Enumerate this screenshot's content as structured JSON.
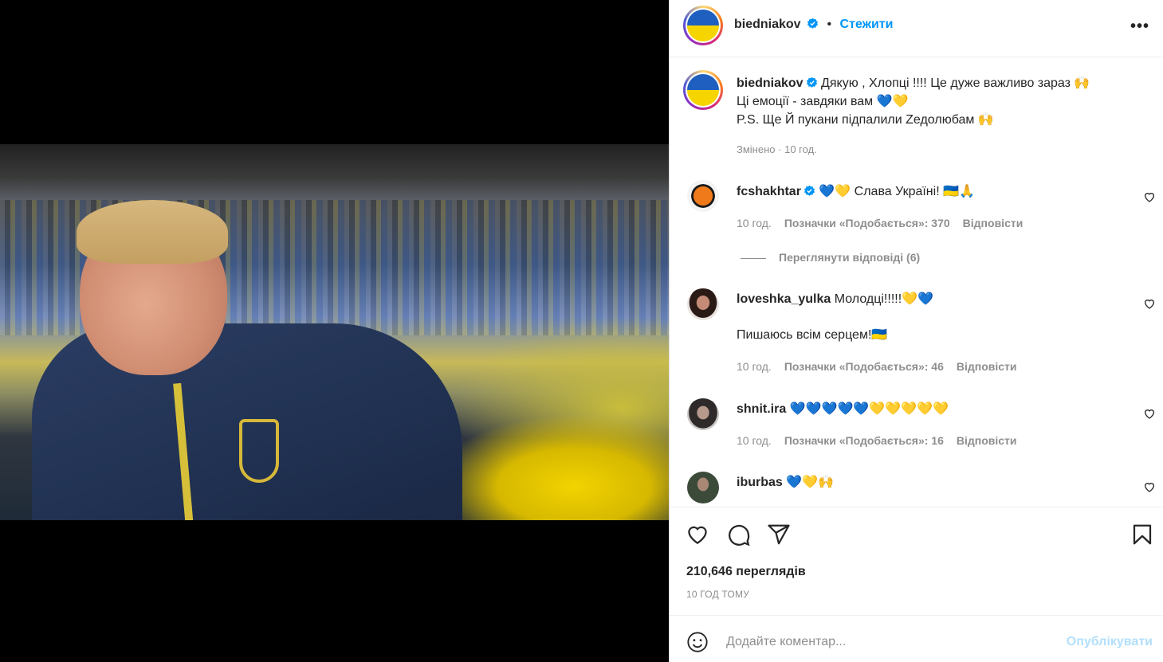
{
  "header": {
    "username": "biedniakov",
    "separator": "•",
    "follow_label": "Стежити",
    "more_label": "•••"
  },
  "caption": {
    "username": "biedniakov",
    "line1": "Дякую , Хлопці !!!! Це дуже важливо зараз 🙌",
    "line2": "Ці емоції - завдяки вам 💙💛",
    "line3": "P.S. Ще Й пукани підпалили Zедолюбам 🙌",
    "meta_edited": "Змінено",
    "meta_separator": "·",
    "meta_time": "10 год."
  },
  "comments": [
    {
      "username": "fcshakhtar",
      "text": "💙💛 Слава Україні! 🇺🇦🙏",
      "time": "10 год.",
      "likes": "Позначки «Подобається»: 370",
      "reply": "Відповісти"
    },
    {
      "username": "loveshka_yulka",
      "text": "Молодці!!!!!💛💙",
      "text2": "Пишаюсь всім серцем!🇺🇦",
      "time": "10 год.",
      "likes": "Позначки «Подобається»: 46",
      "reply": "Відповісти"
    },
    {
      "username": "shnit.ira",
      "text": "💙💙💙💙💙💛💛💛💛💛",
      "time": "10 год.",
      "likes": "Позначки «Подобається»: 16",
      "reply": "Відповісти"
    },
    {
      "username": "iburbas",
      "text": "💙💛🙌"
    }
  ],
  "view_replies": "Переглянути відповіді (6)",
  "actions": {
    "views": "210,646 переглядів",
    "time_ago": "10 ГОД ТОМУ"
  },
  "add_comment": {
    "placeholder": "Додайте коментар...",
    "publish_label": "Опублікувати"
  },
  "colors": {
    "link": "#0095f6",
    "muted": "#8e8e8e",
    "publish_disabled": "#b2dffc",
    "flag_blue": "#1f5fbf",
    "flag_yellow": "#f6d400"
  }
}
